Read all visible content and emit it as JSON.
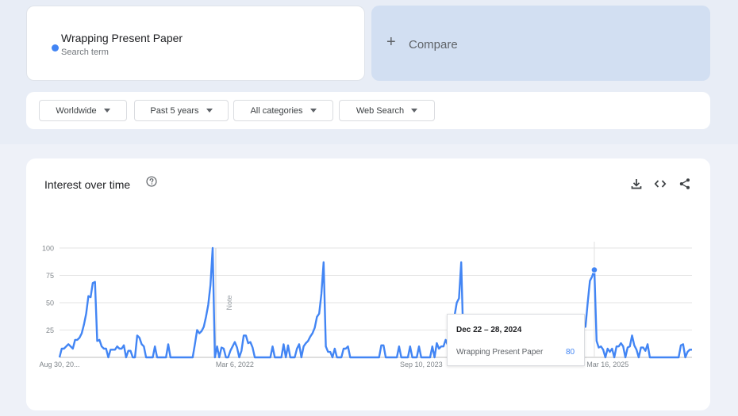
{
  "search_term": {
    "name": "Wrapping Present Paper",
    "subtitle": "Search term",
    "color": "#4285f4"
  },
  "compare": {
    "label": "Compare",
    "icon": "plus-icon"
  },
  "filters": {
    "region": "Worldwide",
    "period": "Past 5 years",
    "category": "All categories",
    "search_type": "Web Search"
  },
  "widget": {
    "title": "Interest over time",
    "icons": [
      "help-icon",
      "download-icon",
      "embed-code-icon",
      "share-icon"
    ]
  },
  "tooltip": {
    "date": "Dec 22 – 28, 2024",
    "term": "Wrapping Present Paper",
    "value": "80"
  },
  "note_label": "Note",
  "chart_data": {
    "type": "line",
    "title": "",
    "xlabel": "",
    "ylabel": "",
    "ylim": [
      0,
      100
    ],
    "y_ticks": [
      "100",
      "75",
      "50",
      "25"
    ],
    "x_tick_labels": [
      "Aug 30, 20...",
      "Mar 6, 2022",
      "Sep 10, 2023",
      "Mar 16, 2025"
    ],
    "grid": true,
    "line_color": "#4285f4",
    "series": [
      {
        "name": "Wrapping Present Paper",
        "values": [
          0,
          8,
          8,
          10,
          12,
          10,
          8,
          16,
          16,
          18,
          22,
          30,
          40,
          56,
          55,
          68,
          69,
          15,
          16,
          10,
          8,
          8,
          0,
          7,
          7,
          7,
          10,
          8,
          8,
          11,
          0,
          6,
          6,
          0,
          0,
          20,
          18,
          12,
          10,
          0,
          0,
          0,
          0,
          10,
          0,
          0,
          0,
          0,
          0,
          12,
          0,
          0,
          0,
          0,
          0,
          0,
          0,
          0,
          0,
          0,
          0,
          12,
          25,
          22,
          24,
          28,
          37,
          48,
          66,
          100,
          0,
          10,
          0,
          9,
          8,
          0,
          0,
          6,
          10,
          14,
          9,
          0,
          6,
          20,
          20,
          13,
          14,
          9,
          0,
          0,
          0,
          0,
          0,
          0,
          0,
          0,
          10,
          0,
          0,
          0,
          0,
          12,
          0,
          11,
          0,
          0,
          0,
          8,
          12,
          0,
          10,
          13,
          15,
          19,
          22,
          27,
          37,
          40,
          58,
          87,
          10,
          5,
          5,
          0,
          8,
          0,
          0,
          0,
          8,
          8,
          10,
          0,
          0,
          0,
          0,
          0,
          0,
          0,
          0,
          0,
          0,
          0,
          0,
          0,
          0,
          11,
          11,
          0,
          0,
          0,
          0,
          0,
          0,
          10,
          0,
          0,
          0,
          0,
          10,
          0,
          0,
          0,
          10,
          0,
          0,
          0,
          0,
          0,
          10,
          0,
          13,
          8,
          10,
          10,
          16,
          11,
          13,
          18,
          38,
          50,
          54,
          87,
          12,
          0,
          0,
          0,
          0,
          0,
          0,
          0,
          0,
          0,
          0,
          0,
          0,
          0,
          0,
          0,
          0,
          0,
          0,
          0,
          0,
          0,
          0,
          0,
          0,
          0,
          0,
          0,
          0,
          0,
          0,
          0,
          0,
          0,
          0,
          0,
          0,
          0,
          0,
          0,
          0,
          0,
          0,
          0,
          0,
          0,
          0,
          0,
          0,
          0,
          0,
          0,
          0,
          6,
          30,
          28,
          50,
          70,
          74,
          80,
          15,
          9,
          10,
          7,
          0,
          8,
          5,
          8,
          0,
          10,
          10,
          13,
          10,
          0,
          9,
          10,
          20,
          11,
          7,
          0,
          9,
          9,
          6,
          12,
          0,
          0,
          0,
          0,
          0,
          0,
          0,
          0,
          0,
          0,
          0,
          0,
          0,
          0,
          11,
          12,
          0,
          5,
          7,
          7
        ]
      }
    ]
  }
}
